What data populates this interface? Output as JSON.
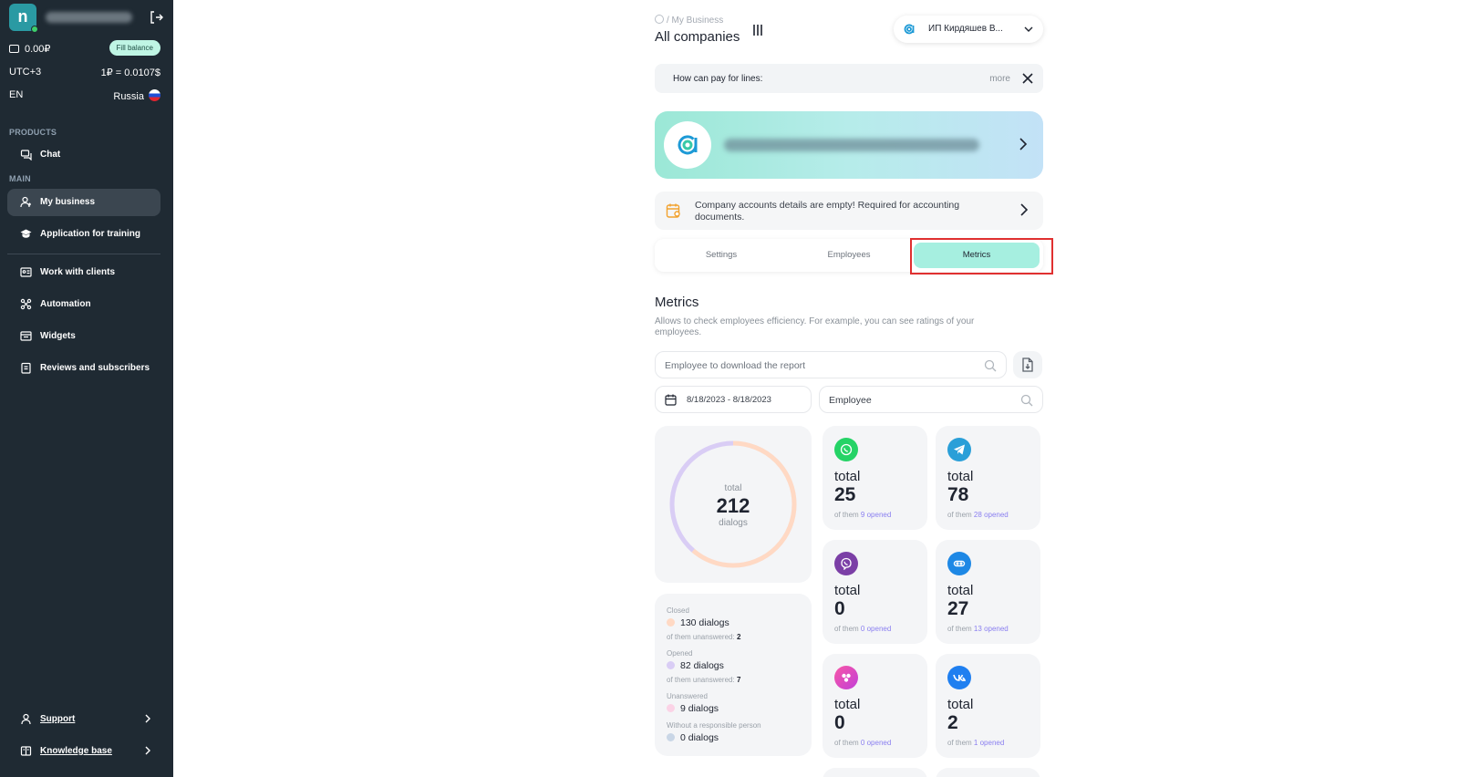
{
  "sidebar": {
    "avatar_letter": "n",
    "balance": "0.00₽",
    "fill_balance_label": "Fill balance",
    "timezone": "UTC+3",
    "rate": "1₽ = 0.0107$",
    "language": "EN",
    "country": "Russia",
    "section_products": "PRODUCTS",
    "section_main": "MAIN",
    "items": [
      {
        "label": "Chat",
        "icon": "chat-icon"
      },
      {
        "label": "My business",
        "icon": "user-icon",
        "active": true
      },
      {
        "label": "Application for training",
        "icon": "graduation-cap-icon"
      },
      {
        "label": "Work with clients",
        "icon": "id-card-icon"
      },
      {
        "label": "Automation",
        "icon": "automation-icon"
      },
      {
        "label": "Widgets",
        "icon": "widgets-icon"
      },
      {
        "label": "Reviews and subscribers",
        "icon": "reviews-icon"
      }
    ],
    "support_label": "Support",
    "knowledge_label": "Knowledge base"
  },
  "header": {
    "breadcrumb": "/ My Business",
    "title": "All companies",
    "company_select": "ИП Кирдяшев В..."
  },
  "notice": {
    "text": "How can pay for lines:",
    "more": "more"
  },
  "warning": {
    "text": "Company accounts details are empty! Required for accounting documents."
  },
  "tabs": [
    {
      "label": "Settings",
      "active": false
    },
    {
      "label": "Employees",
      "active": false
    },
    {
      "label": "Metrics",
      "active": true
    }
  ],
  "metrics": {
    "title": "Metrics",
    "description": "Allows to check employees efficiency. For example, you can see ratings of your employees.",
    "report_placeholder": "Employee to download the report",
    "date_range": "8/18/2023 - 8/18/2023",
    "employee_placeholder": "Employee",
    "total": {
      "label": "total",
      "value": "212",
      "unit": "dialogs"
    },
    "stats": {
      "closed_caption": "Closed",
      "closed_value": "130 dialogs",
      "closed_unanswered_label": "of them unanswered:",
      "closed_unanswered": "2",
      "opened_caption": "Opened",
      "opened_value": "82 dialogs",
      "opened_unanswered_label": "of them unanswered:",
      "opened_unanswered": "7",
      "unanswered_caption": "Unanswered",
      "unanswered_value": "9 dialogs",
      "no_person_caption": "Without a responsible person",
      "no_person_value": "0 dialogs"
    },
    "channels": [
      {
        "icon": "whatsapp-icon",
        "color": "#25d366",
        "label": "total",
        "total": "25",
        "sub_prefix": "of them",
        "opened": "9",
        "sub_suffix": "opened"
      },
      {
        "icon": "telegram-icon",
        "color": "#2a9fd8",
        "label": "total",
        "total": "78",
        "sub_prefix": "of them",
        "opened": "28",
        "sub_suffix": "opened"
      },
      {
        "icon": "viber-icon",
        "color": "#7b3fa6",
        "label": "total",
        "total": "0",
        "sub_prefix": "of them",
        "opened": "0",
        "sub_suffix": "opened"
      },
      {
        "icon": "webchat-icon",
        "color": "#1e88e5",
        "label": "total",
        "total": "27",
        "sub_prefix": "of them",
        "opened": "13",
        "sub_suffix": "opened"
      },
      {
        "icon": "instagram-icon",
        "color": "#e5478b",
        "label": "total",
        "total": "0",
        "sub_prefix": "of them",
        "opened": "0",
        "sub_suffix": "opened"
      },
      {
        "icon": "vk-icon",
        "color": "#1f7ff0",
        "label": "total",
        "total": "2",
        "sub_prefix": "of them",
        "opened": "1",
        "sub_suffix": "opened"
      }
    ],
    "donut": {
      "closed": 130,
      "opened": 82,
      "total": 212,
      "colors": {
        "closed": "#ffd9c4",
        "opened": "#d9cdf5"
      }
    }
  },
  "colors": {
    "sidebar_bg": "#1f2a33",
    "accent": "#a6efe0",
    "highlight": "#e03030"
  }
}
